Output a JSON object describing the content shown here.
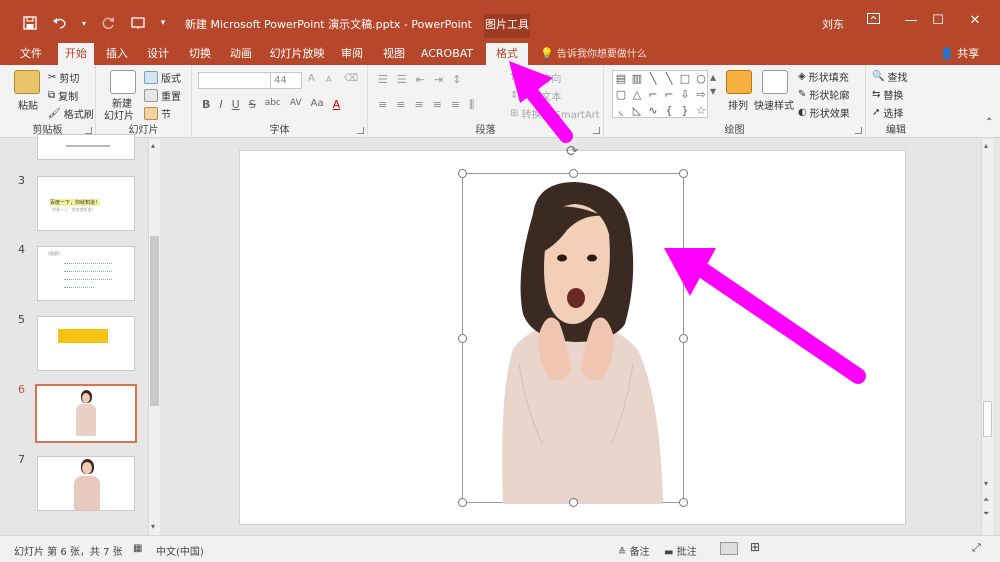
{
  "window": {
    "doc_title": "新建 Microsoft PowerPoint 演示文稿.pptx  -  PowerPoint",
    "context_group": "图片工具",
    "user": "刘东",
    "minimize": "—",
    "restore": "❐",
    "maximize": "☐",
    "close": "✕"
  },
  "tabs": [
    "文件",
    "开始",
    "插入",
    "设计",
    "切换",
    "动画",
    "幻灯片放映",
    "审阅",
    "视图",
    "ACROBAT",
    "格式"
  ],
  "tell_me": "告诉我你想要做什么",
  "share": "共享",
  "ribbon": {
    "clipboard": {
      "label": "剪贴板",
      "paste": "粘贴",
      "cut": "剪切",
      "copy": "复制",
      "format_painter": "格式刷"
    },
    "slides": {
      "label": "幻灯片",
      "new_slide": "新建",
      "new_slide2": "幻灯片",
      "layout": "版式",
      "reset": "重置",
      "section": "节"
    },
    "font": {
      "label": "字体",
      "size": "44",
      "bold": "B",
      "italic": "I",
      "underline": "U",
      "strike": "S",
      "shadow": "abc",
      "spacing": "AV",
      "case": "Aa",
      "color": "A",
      "grow": "A",
      "shrink": "A"
    },
    "paragraph": {
      "label": "段落",
      "text_dir": "文字方向",
      "align_text": "对齐文本",
      "smartart": "转换为 SmartArt"
    },
    "drawing": {
      "label": "绘图",
      "arrange": "排列",
      "quick_styles": "快速样式",
      "shape_fill": "形状填充",
      "shape_outline": "形状轮廓",
      "shape_effects": "形状效果"
    },
    "editing": {
      "label": "编辑",
      "find": "查找",
      "replace": "替换",
      "select": "选择"
    }
  },
  "thumbnails": [
    {
      "num": "3",
      "line1": "百度一下，你就知道！",
      "line2": "世界一上“  类你就知道！"
    },
    {
      "num": "4",
      "heading": "《搜索》"
    },
    {
      "num": "5"
    },
    {
      "num": "6"
    },
    {
      "num": "7"
    }
  ],
  "status": {
    "slide_info": "幻灯片 第 6 张，共 7 张",
    "language": "中文(中国)",
    "notes": "备注",
    "comments": "批注"
  },
  "colors": {
    "brand": "#b7472a",
    "annotation_arrow": "#ff00ff",
    "selection_accent": "#d9724e"
  }
}
